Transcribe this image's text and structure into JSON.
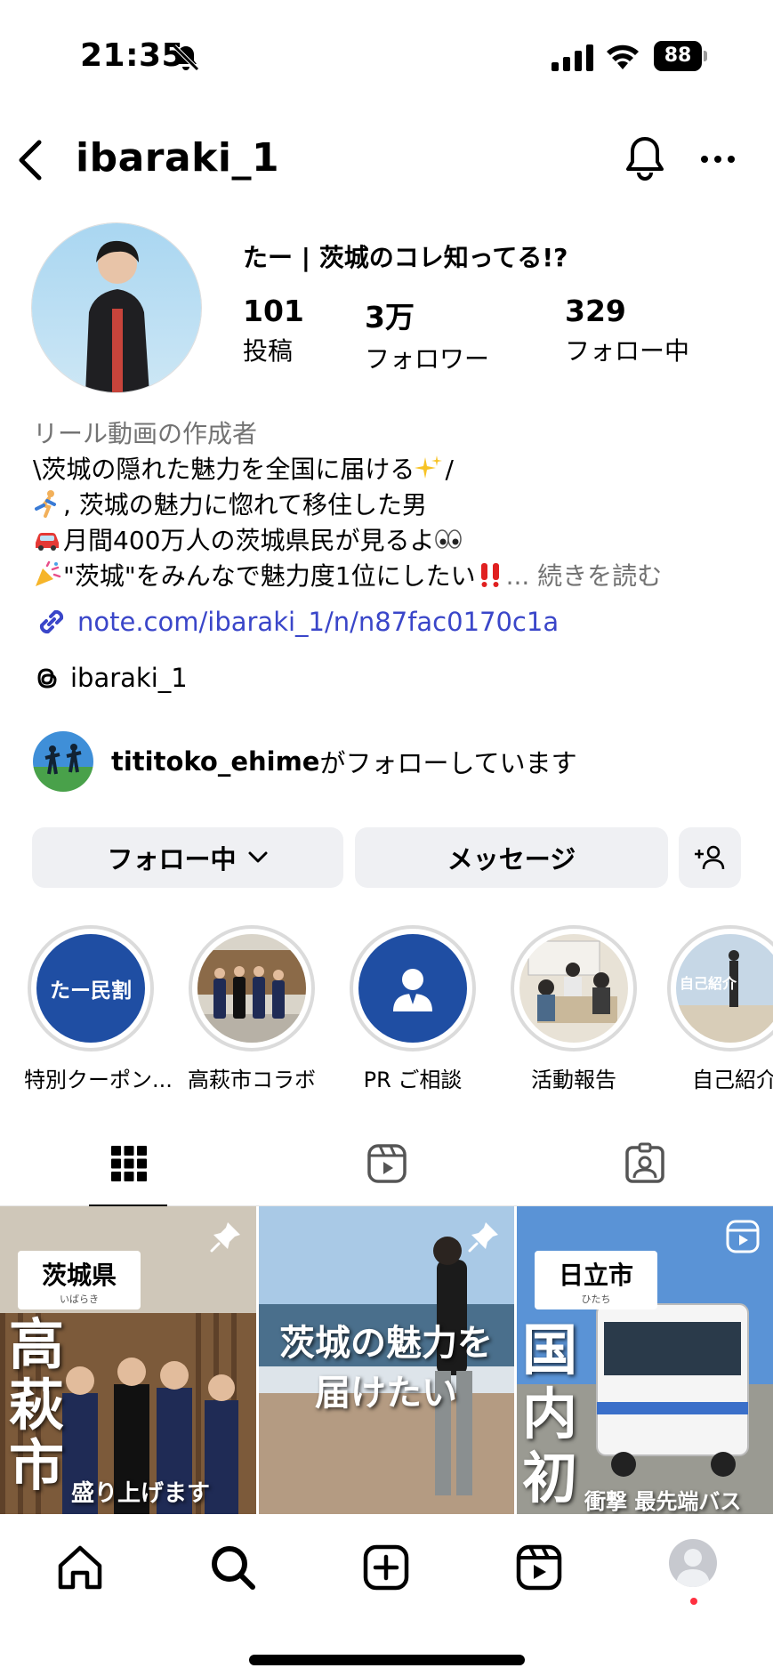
{
  "status_bar": {
    "time": "21:35",
    "battery": "88"
  },
  "header": {
    "username": "ibaraki_1"
  },
  "profile": {
    "display_name": "たー | 茨城のコレ知ってる!?",
    "stats": [
      {
        "value": "101",
        "label": "投稿"
      },
      {
        "value": "3万",
        "label": "フォロワー"
      },
      {
        "value": "329",
        "label": "フォロー中"
      }
    ],
    "category": "リール動画の作成者",
    "bio_lines": [
      "\\茨城の隠れた魅力を全国に届ける",
      "/",
      ", 茨城の魅力に惚れて移住した男",
      "月間400万人の茨城県民が見るよ",
      "\"茨城\"をみんなで魅力度1位にしたい",
      "... 続きを読む"
    ],
    "link": "note.com/ibaraki_1/n/n87fac0170c1a",
    "threads_handle": "ibaraki_1",
    "mutual_name": "tititoko_ehime",
    "mutual_suffix": "がフォローしています"
  },
  "buttons": {
    "following": "フォロー中",
    "message": "メッセージ"
  },
  "highlights": [
    {
      "label": "特別クーポン...",
      "cover_text": "たー民割"
    },
    {
      "label": "高萩市コラボ"
    },
    {
      "label": "PR ご相談"
    },
    {
      "label": "活動報告"
    },
    {
      "label": "自己紹介",
      "cover_text": "自己紹介"
    }
  ],
  "posts": [
    {
      "tag": "茨城県",
      "tag_sub": "いばらき",
      "big": [
        "高",
        "萩",
        "市"
      ],
      "caption": "盛り上げます",
      "pinned": true
    },
    {
      "title_lines": [
        "茨城の魅力を",
        "届けたい"
      ],
      "pinned": true
    },
    {
      "tag": "日立市",
      "tag_sub": "ひたち",
      "big": [
        "国",
        "内",
        "初"
      ],
      "caption": "衝撃 最先端バス",
      "reel": true
    }
  ],
  "colors": {
    "link": "#3a46c9",
    "button_bg": "#eff0f3",
    "highlight_blue": "#1f4ea3",
    "muted": "#737373",
    "notification_dot": "#ff3040"
  }
}
